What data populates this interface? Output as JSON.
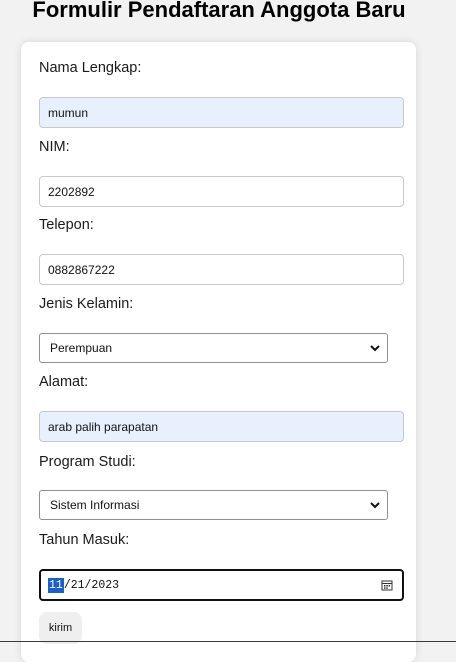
{
  "page": {
    "title": "Formulir Pendaftaran Anggota Baru"
  },
  "form": {
    "nama": {
      "label": "Nama Lengkap:",
      "value": "mumun"
    },
    "nim": {
      "label": "NIM:",
      "value": "2202892"
    },
    "telepon": {
      "label": "Telepon:",
      "value": "0882867222"
    },
    "jenis_kelamin": {
      "label": "Jenis Kelamin:",
      "selected": "Perempuan"
    },
    "alamat": {
      "label": "Alamat:",
      "value": "arab palih parapatan"
    },
    "program_studi": {
      "label": "Program Studi:",
      "selected": "Sistem Informasi"
    },
    "tahun_masuk": {
      "label": "Tahun Masuk:",
      "month": "11",
      "rest": "/21/2023"
    },
    "submit_label": "kirim"
  },
  "colors": {
    "autofill_bg": "#e8f0fe",
    "date_focus_border": "#101010",
    "date_segment_highlight": "#1a5fd0"
  },
  "icons": {
    "select_arrow": "chevron-down-icon",
    "date_picker": "calendar-icon"
  }
}
